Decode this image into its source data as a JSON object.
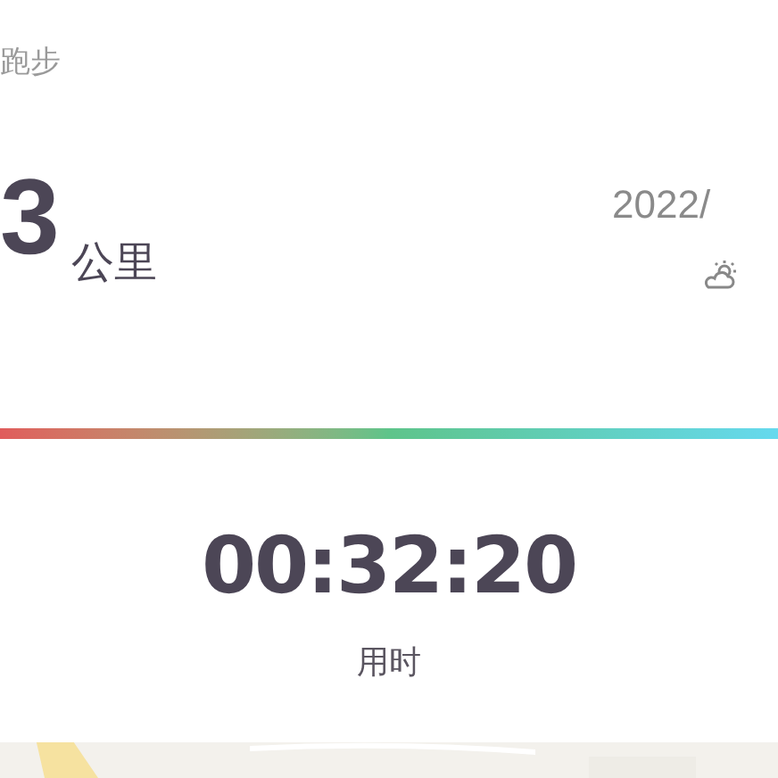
{
  "activity": {
    "type": "跑步",
    "distance": "3",
    "unit": "公里"
  },
  "date": {
    "text": "2022/"
  },
  "progress": {
    "kind": "gradient"
  },
  "duration": {
    "value": "00:32:20",
    "label": "用时"
  }
}
